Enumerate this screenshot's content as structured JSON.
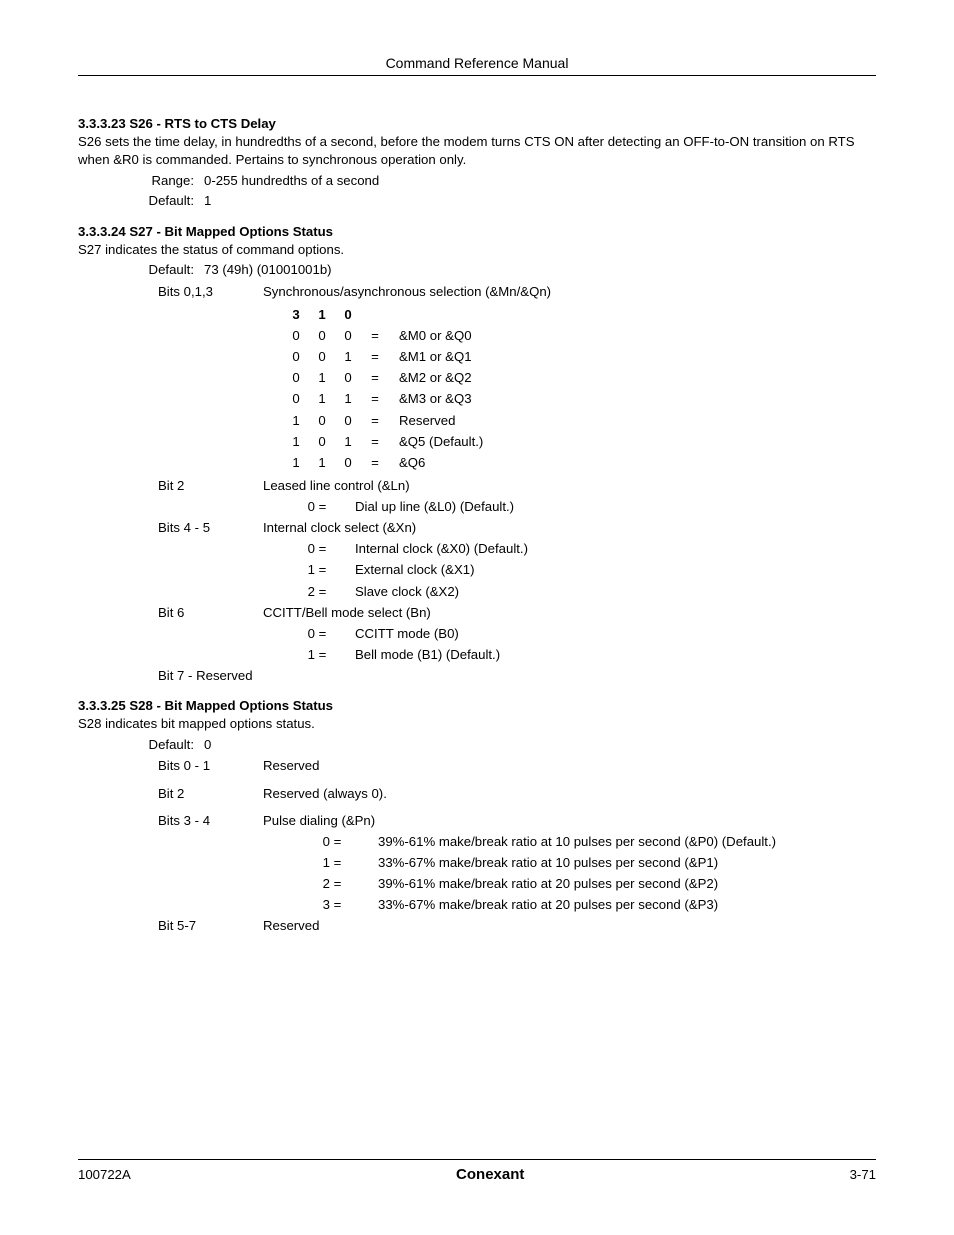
{
  "header": {
    "title": "Command Reference Manual"
  },
  "s26": {
    "heading": "3.3.3.23 S26 - RTS to CTS Delay",
    "para": " S26 sets the time delay, in hundredths of a second, before the modem turns CTS ON after detecting an OFF-to-ON transition on RTS when &R0 is commanded. Pertains to synchronous operation only.",
    "range_label": "Range:",
    "range_val": "0-255 hundredths of a second",
    "default_label": "Default:",
    "default_val": "1"
  },
  "s27": {
    "heading": "3.3.3.24 S27 - Bit Mapped Options Status",
    "para": " S27 indicates the status of command options.",
    "default_label": "Default:",
    "default_val": "73 (49h) (01001001b)",
    "bits013_label": "Bits 0,1,3",
    "bits013_desc": "Synchronous/asynchronous selection (&Mn/&Qn)",
    "bit_header": {
      "c3": "3",
      "c1": "1",
      "c0": "0"
    },
    "bit_rows": [
      {
        "c3": "0",
        "c1": "0",
        "c0": "0",
        "eq": "=",
        "mean": "&M0 or &Q0"
      },
      {
        "c3": "0",
        "c1": "0",
        "c0": "1",
        "eq": "=",
        "mean": "&M1 or &Q1"
      },
      {
        "c3": "0",
        "c1": "1",
        "c0": "0",
        "eq": "=",
        "mean": "&M2 or &Q2"
      },
      {
        "c3": "0",
        "c1": "1",
        "c0": "1",
        "eq": "=",
        "mean": "&M3 or &Q3"
      },
      {
        "c3": "1",
        "c1": "0",
        "c0": "0",
        "eq": "=",
        "mean": "Reserved"
      },
      {
        "c3": "1",
        "c1": "0",
        "c0": "1",
        "eq": "=",
        "mean": "&Q5 (Default.)"
      },
      {
        "c3": "1",
        "c1": "1",
        "c0": "0",
        "eq": "=",
        "mean": "&Q6"
      }
    ],
    "bit2_label": "Bit 2",
    "bit2_desc": "Leased line control (&Ln)",
    "bit2_rows": [
      {
        "code": "0 =",
        "mean": "Dial up line (&L0) (Default.)"
      }
    ],
    "bits45_label": "Bits 4 - 5",
    "bits45_desc": "Internal clock select (&Xn)",
    "bits45_rows": [
      {
        "code": "0 =",
        "mean": "Internal clock (&X0) (Default.)"
      },
      {
        "code": "1 =",
        "mean": "External clock (&X1)"
      },
      {
        "code": "2 =",
        "mean": "Slave clock (&X2)"
      }
    ],
    "bit6_label": "Bit 6",
    "bit6_desc": "CCITT/Bell mode select (Bn)",
    "bit6_rows": [
      {
        "code": "0 =",
        "mean": "CCITT mode (B0)"
      },
      {
        "code": "1 =",
        "mean": "Bell mode (B1) (Default.)"
      }
    ],
    "bit7": "Bit 7 - Reserved"
  },
  "s28": {
    "heading": "3.3.3.25 S28 - Bit Mapped Options Status",
    "para": "S28 indicates bit mapped options status.",
    "default_label": "Default:",
    "default_val": "0",
    "rows": [
      {
        "label": "Bits 0 - 1",
        "desc": "Reserved"
      },
      {
        "label": "Bit 2",
        "desc": "Reserved (always 0)."
      },
      {
        "label": "Bits 3 - 4",
        "desc": "Pulse dialing (&Pn)"
      }
    ],
    "bits34_rows": [
      {
        "code": "0 =",
        "mean": "39%-61% make/break ratio at 10 pulses per second (&P0) (Default.)"
      },
      {
        "code": "1 =",
        "mean": "33%-67% make/break ratio at 10 pulses per second (&P1)"
      },
      {
        "code": "2 =",
        "mean": "39%-61% make/break ratio at 20 pulses per second (&P2)"
      },
      {
        "code": "3 =",
        "mean": "33%-67% make/break ratio at 20 pulses per second (&P3)"
      }
    ],
    "bit57_label": "Bit 5-7",
    "bit57_desc": "Reserved"
  },
  "footer": {
    "left": "100722A",
    "center": "Conexant",
    "right": "3-71"
  }
}
